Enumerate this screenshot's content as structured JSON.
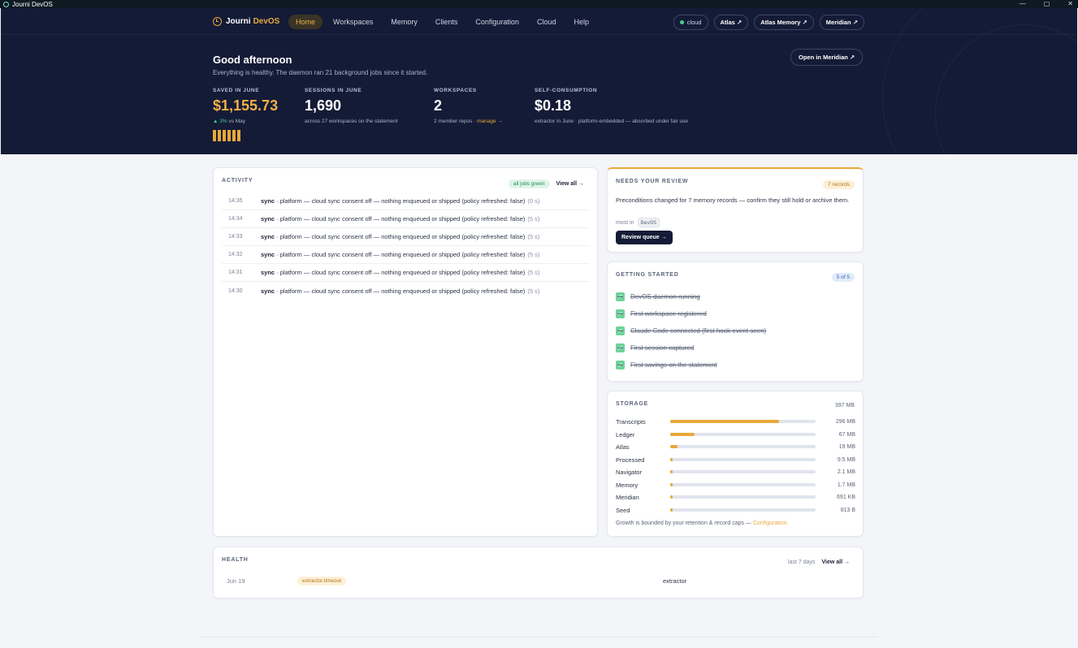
{
  "window": {
    "title": "Journi DevOS"
  },
  "brand": {
    "name": "Journi",
    "accent": "DevOS"
  },
  "nav": {
    "links": [
      "Home",
      "Workspaces",
      "Memory",
      "Clients",
      "Configuration",
      "Cloud",
      "Help"
    ],
    "active": "Home",
    "cloud_status": "cloud",
    "external": [
      "Atlas ↗",
      "Atlas Memory ↗",
      "Meridian ↗"
    ]
  },
  "hero": {
    "greeting": "Good afternoon",
    "subtitle": "Everything is healthy. The daemon ran 21 background jobs since it started.",
    "open_button": "Open in Meridian ↗",
    "stats": [
      {
        "label": "SAVED IN JUNE",
        "value": "$1,155.73",
        "trend": "▲ 3%",
        "trend_suffix": " vs May"
      },
      {
        "label": "SESSIONS IN JUNE",
        "value": "1,690",
        "sub": "across 27 workspaces on the statement"
      },
      {
        "label": "WORKSPACES",
        "value": "2",
        "sub": "2 member repos · ",
        "link": "manage →"
      },
      {
        "label": "SELF-CONSUMPTION",
        "value": "$0.18",
        "sub": "extractor in June · platform-embedded — absorbed under fair use"
      }
    ]
  },
  "activity": {
    "title": "ACTIVITY",
    "badge": "all jobs green",
    "view_all": "View all →",
    "rows": [
      {
        "time": "14:35",
        "kind": "sync",
        "msg": "· platform — cloud sync consent off — nothing enqueued or shipped (policy refreshed: false)",
        "dur": "(0 s)"
      },
      {
        "time": "14:34",
        "kind": "sync",
        "msg": "· platform — cloud sync consent off — nothing enqueued or shipped (policy refreshed: false)",
        "dur": "(5 s)"
      },
      {
        "time": "14:33",
        "kind": "sync",
        "msg": "· platform — cloud sync consent off — nothing enqueued or shipped (policy refreshed: false)",
        "dur": "(5 s)"
      },
      {
        "time": "14:32",
        "kind": "sync",
        "msg": "· platform — cloud sync consent off — nothing enqueued or shipped (policy refreshed: false)",
        "dur": "(5 s)"
      },
      {
        "time": "14:31",
        "kind": "sync",
        "msg": "· platform — cloud sync consent off — nothing enqueued or shipped (policy refreshed: false)",
        "dur": "(5 s)"
      },
      {
        "time": "14:30",
        "kind": "sync",
        "msg": "· platform — cloud sync consent off — nothing enqueued or shipped (policy refreshed: false)",
        "dur": "(5 s)"
      }
    ]
  },
  "review": {
    "title": "NEEDS YOUR REVIEW",
    "badge": "7 records",
    "text": "Preconditions changed for 7 memory records — confirm they still hold or archive them.",
    "most_in_label": "most in",
    "most_in_value": "DevOS",
    "button": "Review queue →"
  },
  "getting_started": {
    "title": "GETTING STARTED",
    "badge": "5 of 5",
    "items": [
      "DevOS daemon running",
      "First workspace registered",
      "Claude Code connected (first hook event seen)",
      "First session captured",
      "First savings on the statement"
    ]
  },
  "storage": {
    "title": "STORAGE",
    "total": "397 MB",
    "rows": [
      {
        "name": "Transcripts",
        "size": "296 MB",
        "fraction": 0.75
      },
      {
        "name": "Ledger",
        "size": "67 MB",
        "fraction": 0.17
      },
      {
        "name": "Atlas",
        "size": "19 MB",
        "fraction": 0.05
      },
      {
        "name": "Processed",
        "size": "9.5 MB",
        "fraction": 0.018
      },
      {
        "name": "Navigator",
        "size": "2.1 MB",
        "fraction": 0.015
      },
      {
        "name": "Memory",
        "size": "1.7 MB",
        "fraction": 0.015
      },
      {
        "name": "Meridian",
        "size": "691 KB",
        "fraction": 0.012
      },
      {
        "name": "Seed",
        "size": "813 B",
        "fraction": 0.01
      }
    ],
    "footer": "Growth is bounded by your retention & record caps — ",
    "footer_link": "Configuration."
  },
  "health": {
    "title": "HEALTH",
    "range": "last 7 days",
    "view_all": "View all →",
    "rows": [
      {
        "date": "Jun 19",
        "tag": "extractor.timeout",
        "source": "extractor"
      }
    ]
  },
  "colors": {
    "accent": "#e8a83a",
    "hero_bg": "#141b36",
    "ok": "#41d18a"
  }
}
